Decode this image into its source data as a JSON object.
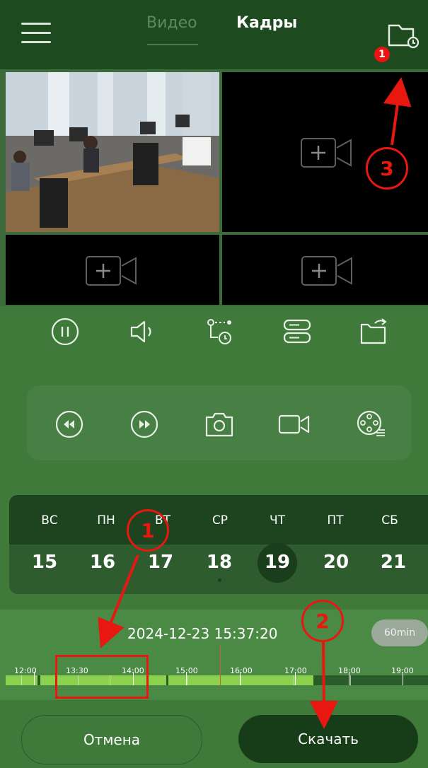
{
  "header": {
    "tab_video": "Видео",
    "tab_frames": "Кадры",
    "badge_count": "1",
    "icons": {
      "menu": "menu-icon",
      "folder": "folder-download-icon"
    }
  },
  "video_grid": {
    "cells": [
      {
        "content": "office-camera-feed"
      },
      {
        "content": "add-camera"
      },
      {
        "content": "add-camera"
      },
      {
        "content": "add-camera"
      }
    ],
    "add_camera_icon": "add-camera-icon"
  },
  "controls": {
    "row1": [
      "pause-icon",
      "volume-icon",
      "route-icon",
      "storage-icon",
      "export-folder-icon"
    ],
    "row2": [
      "rewind-icon",
      "fast-forward-icon",
      "snapshot-camera-icon",
      "record-video-icon",
      "film-reel-icon"
    ]
  },
  "calendar": {
    "weekdays": [
      "ВС",
      "ПН",
      "ВТ",
      "СР",
      "ЧТ",
      "ПТ",
      "СБ"
    ],
    "dates": [
      "15",
      "16",
      "17",
      "18",
      "19",
      "20",
      "21"
    ],
    "selected": "19"
  },
  "timeline": {
    "datetime": "2024-12-23  15:37:20",
    "zoom": "60min",
    "ticks": [
      "12:00",
      "13:30",
      "14:00",
      "15:00",
      "16:00",
      "17:00",
      "18:00",
      "19:00"
    ]
  },
  "buttons": {
    "cancel": "Отмена",
    "download": "Скачать"
  },
  "annotations": {
    "step1": "1",
    "step2": "2",
    "step3": "3",
    "color": "#e8170f"
  },
  "colors": {
    "header": "#1e4a1f",
    "background": "#3f7a3b",
    "recording": "#8bd14d",
    "download_button": "#173d18"
  }
}
